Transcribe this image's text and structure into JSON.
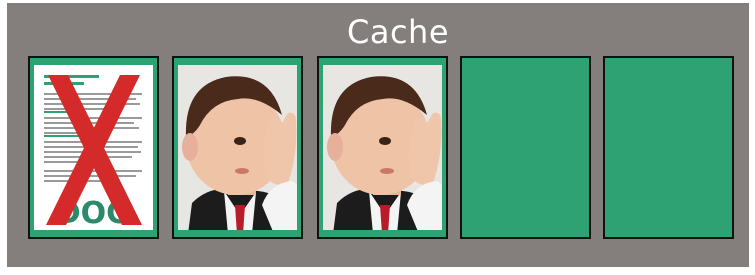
{
  "cache": {
    "title": "Cache",
    "slot_fill_color": "#2ea272",
    "panel_color": "#847e7c",
    "slots": [
      {
        "state": "evicted",
        "content": "document-icon",
        "overlay": "red-x-icon"
      },
      {
        "state": "filled",
        "content": "child-photo"
      },
      {
        "state": "filled",
        "content": "child-photo"
      },
      {
        "state": "empty"
      },
      {
        "state": "empty"
      }
    ]
  },
  "document": {
    "watermark_text": "DOC"
  }
}
